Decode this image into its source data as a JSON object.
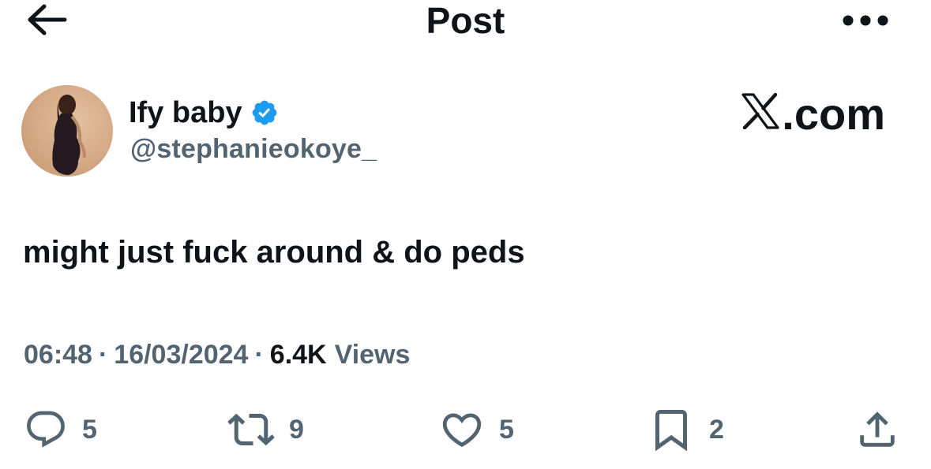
{
  "header": {
    "title": "Post",
    "back_icon": "arrow-left-icon",
    "more_icon": "more-horizontal-icon"
  },
  "author": {
    "display_name": "Ify baby",
    "handle": "@stephanieokoye_",
    "verified": true,
    "verified_color": "#1d9bf0"
  },
  "watermark": {
    "text": ".com"
  },
  "tweet": {
    "text": "might just fuck around & do peds"
  },
  "meta": {
    "time": "06:48",
    "separator": "·",
    "date": "16/03/2024",
    "views_count": "6.4K",
    "views_label": "Views"
  },
  "actions": {
    "replies": "5",
    "reposts": "9",
    "likes": "5",
    "bookmarks": "2"
  },
  "colors": {
    "text_primary": "#0f1419",
    "text_secondary": "#536471",
    "accent": "#1d9bf0"
  }
}
